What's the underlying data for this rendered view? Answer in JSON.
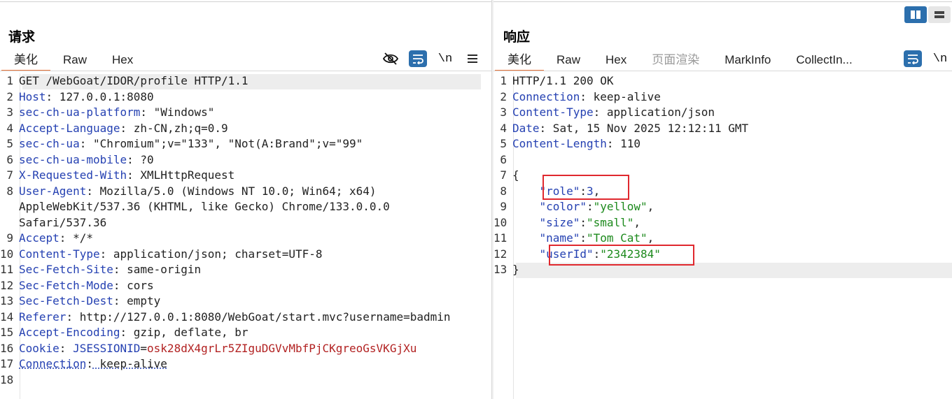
{
  "layout": {
    "split_icon": "split-columns-icon",
    "single_icon": "single-view-icon"
  },
  "request": {
    "title": "请求",
    "tabs": [
      {
        "label": "美化",
        "active": true
      },
      {
        "label": "Raw",
        "active": false
      },
      {
        "label": "Hex",
        "active": false
      }
    ],
    "tools": {
      "hide": "eye-off-icon",
      "wrap": "wrap-lines-icon",
      "newline": "\\n",
      "menu": "hamburger-menu-icon"
    },
    "lines": [
      {
        "n": "1",
        "k": "GET /WebGoat/IDOR/profile HTTP/1.1",
        "v": ""
      },
      {
        "n": "2",
        "k": "Host",
        "v": " 127.0.0.1:8080"
      },
      {
        "n": "3",
        "k": "sec-ch-ua-platform",
        "v": " \"Windows\""
      },
      {
        "n": "4",
        "k": "Accept-Language",
        "v": " zh-CN,zh;q=0.9"
      },
      {
        "n": "5",
        "k": "sec-ch-ua",
        "v": " \"Chromium\";v=\"133\", \"Not(A:Brand\";v=\"99\""
      },
      {
        "n": "6",
        "k": "sec-ch-ua-mobile",
        "v": " ?0"
      },
      {
        "n": "7",
        "k": "X-Requested-With",
        "v": " XMLHttpRequest"
      },
      {
        "n": "8",
        "k": "User-Agent",
        "v": " Mozilla/5.0 (Windows NT 10.0; Win64; x64)"
      },
      {
        "n": "",
        "k": "",
        "v": "AppleWebKit/537.36 (KHTML, like Gecko) Chrome/133.0.0.0"
      },
      {
        "n": "",
        "k": "",
        "v": "Safari/537.36"
      },
      {
        "n": "9",
        "k": "Accept",
        "v": " */*"
      },
      {
        "n": "10",
        "k": "Content-Type",
        "v": " application/json; charset=UTF-8"
      },
      {
        "n": "11",
        "k": "Sec-Fetch-Site",
        "v": " same-origin"
      },
      {
        "n": "12",
        "k": "Sec-Fetch-Mode",
        "v": " cors"
      },
      {
        "n": "13",
        "k": "Sec-Fetch-Dest",
        "v": " empty"
      },
      {
        "n": "14",
        "k": "Referer",
        "v": " http://127.0.0.1:8080/WebGoat/start.mvc?username=badmin"
      },
      {
        "n": "15",
        "k": "Accept-Encoding",
        "v": " gzip, deflate, br"
      },
      {
        "n": "16",
        "k": "Cookie",
        "v": ""
      },
      {
        "n": "17",
        "k": "Connection",
        "v": " keep-alive"
      },
      {
        "n": "18",
        "k": "",
        "v": ""
      }
    ],
    "cookie": {
      "name": "JSESSIONID",
      "eq": "=",
      "value": "osk28dX4grLr5ZIguDGVvMbfPjCKgreoGsVKGjXu"
    }
  },
  "response": {
    "title": "响应",
    "tabs": [
      {
        "label": "美化",
        "active": true
      },
      {
        "label": "Raw",
        "active": false
      },
      {
        "label": "Hex",
        "active": false
      },
      {
        "label": "页面渲染",
        "active": false,
        "disabled": true
      },
      {
        "label": "MarkInfo",
        "active": false
      },
      {
        "label": "CollectIn...",
        "active": false
      }
    ],
    "tools": {
      "wrap": "wrap-lines-icon",
      "newline": "\\n"
    },
    "headers": [
      {
        "n": "1",
        "k": "HTTP/1.1 200 OK",
        "v": ""
      },
      {
        "n": "2",
        "k": "Connection",
        "v": " keep-alive"
      },
      {
        "n": "3",
        "k": "Content-Type",
        "v": " application/json"
      },
      {
        "n": "4",
        "k": "Date",
        "v": " Sat, 15 Nov 2025 12:12:11 GMT"
      },
      {
        "n": "5",
        "k": "Content-Length",
        "v": " 110"
      },
      {
        "n": "6",
        "k": "",
        "v": ""
      }
    ],
    "json_open": {
      "n": "7",
      "t": "{"
    },
    "json": [
      {
        "n": "8",
        "key": "\"role\"",
        "val": "3",
        "type": "num",
        "comma": ","
      },
      {
        "n": "9",
        "key": "\"color\"",
        "val": "\"yellow\"",
        "type": "str",
        "comma": ","
      },
      {
        "n": "10",
        "key": "\"size\"",
        "val": "\"small\"",
        "type": "str",
        "comma": ","
      },
      {
        "n": "11",
        "key": "\"name\"",
        "val": "\"Tom Cat\"",
        "type": "str",
        "comma": ","
      },
      {
        "n": "12",
        "key": "\"userId\"",
        "val": "\"2342384\"",
        "type": "str",
        "comma": ""
      }
    ],
    "json_close": {
      "n": "13",
      "t": "}"
    }
  }
}
